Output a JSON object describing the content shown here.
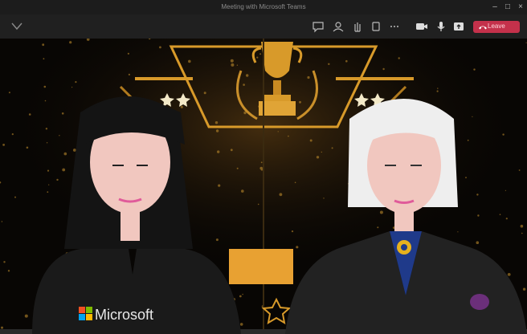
{
  "window": {
    "title": "Meeting with Microsoft Teams"
  },
  "toolbar": {
    "buttons": [
      {
        "name": "chat-icon",
        "label": "Chat"
      },
      {
        "name": "people-icon",
        "label": "People"
      },
      {
        "name": "raise-hand-icon",
        "label": "Raise"
      },
      {
        "name": "react-icon",
        "label": "React"
      },
      {
        "name": "more-icon",
        "label": "More"
      },
      {
        "name": "camera-icon",
        "label": "Camera"
      },
      {
        "name": "mic-icon",
        "label": "Mic"
      },
      {
        "name": "share-icon",
        "label": "Share"
      }
    ],
    "leave_label": "Leave"
  },
  "stage": {
    "background_theme": "gold-trophy-award-stage",
    "shirt_logo_text": "Microsoft",
    "colors": {
      "gold": "#d89a2a",
      "leave_red": "#c4314b",
      "bg_dark": "#080604"
    }
  }
}
